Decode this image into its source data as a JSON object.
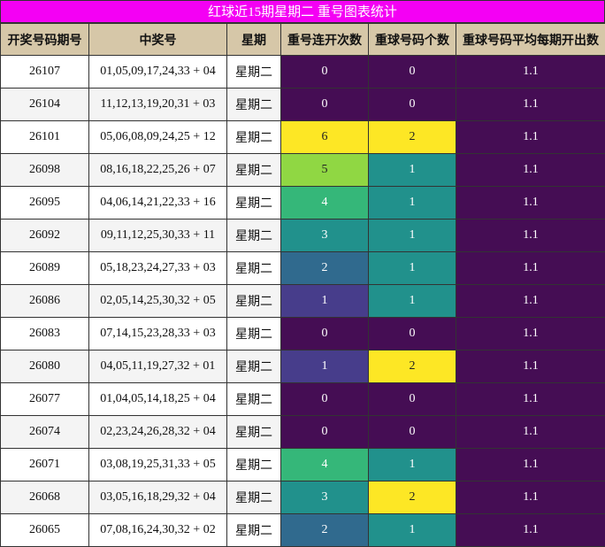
{
  "title": "红球近15期星期二 重号图表统计",
  "colors": {
    "title_bg": "#f400f4",
    "header_bg": "#d6c7a8",
    "heat_scale": {
      "0": "#450d54",
      "1": "#473d8b",
      "2": "#306a8e",
      "3": "#21918c",
      "4": "#35b779",
      "5": "#90d743",
      "6": "#fde725"
    },
    "count_scale": {
      "0": "#450d54",
      "1": "#21918c",
      "2": "#fde725"
    },
    "avg_bg": "#450d54"
  },
  "headers": [
    "开奖号码期号",
    "中奖号",
    "星期",
    "重号连开次数",
    "重球号码个数",
    "重球号码平均每期开出数"
  ],
  "rows": [
    {
      "issue": "26107",
      "numbers": "01,05,09,17,24,33 + 04",
      "weekday": "星期二",
      "streak": "0",
      "count": "0",
      "avg": "1.1"
    },
    {
      "issue": "26104",
      "numbers": "11,12,13,19,20,31 + 03",
      "weekday": "星期二",
      "streak": "0",
      "count": "0",
      "avg": "1.1"
    },
    {
      "issue": "26101",
      "numbers": "05,06,08,09,24,25 + 12",
      "weekday": "星期二",
      "streak": "6",
      "count": "2",
      "avg": "1.1"
    },
    {
      "issue": "26098",
      "numbers": "08,16,18,22,25,26 + 07",
      "weekday": "星期二",
      "streak": "5",
      "count": "1",
      "avg": "1.1"
    },
    {
      "issue": "26095",
      "numbers": "04,06,14,21,22,33 + 16",
      "weekday": "星期二",
      "streak": "4",
      "count": "1",
      "avg": "1.1"
    },
    {
      "issue": "26092",
      "numbers": "09,11,12,25,30,33 + 11",
      "weekday": "星期二",
      "streak": "3",
      "count": "1",
      "avg": "1.1"
    },
    {
      "issue": "26089",
      "numbers": "05,18,23,24,27,33 + 03",
      "weekday": "星期二",
      "streak": "2",
      "count": "1",
      "avg": "1.1"
    },
    {
      "issue": "26086",
      "numbers": "02,05,14,25,30,32 + 05",
      "weekday": "星期二",
      "streak": "1",
      "count": "1",
      "avg": "1.1"
    },
    {
      "issue": "26083",
      "numbers": "07,14,15,23,28,33 + 03",
      "weekday": "星期二",
      "streak": "0",
      "count": "0",
      "avg": "1.1"
    },
    {
      "issue": "26080",
      "numbers": "04,05,11,19,27,32 + 01",
      "weekday": "星期二",
      "streak": "1",
      "count": "2",
      "avg": "1.1"
    },
    {
      "issue": "26077",
      "numbers": "01,04,05,14,18,25 + 04",
      "weekday": "星期二",
      "streak": "0",
      "count": "0",
      "avg": "1.1"
    },
    {
      "issue": "26074",
      "numbers": "02,23,24,26,28,32 + 04",
      "weekday": "星期二",
      "streak": "0",
      "count": "0",
      "avg": "1.1"
    },
    {
      "issue": "26071",
      "numbers": "03,08,19,25,31,33 + 05",
      "weekday": "星期二",
      "streak": "4",
      "count": "1",
      "avg": "1.1"
    },
    {
      "issue": "26068",
      "numbers": "03,05,16,18,29,32 + 04",
      "weekday": "星期二",
      "streak": "3",
      "count": "2",
      "avg": "1.1"
    },
    {
      "issue": "26065",
      "numbers": "07,08,16,24,30,32 + 02",
      "weekday": "星期二",
      "streak": "2",
      "count": "1",
      "avg": "1.1"
    }
  ]
}
